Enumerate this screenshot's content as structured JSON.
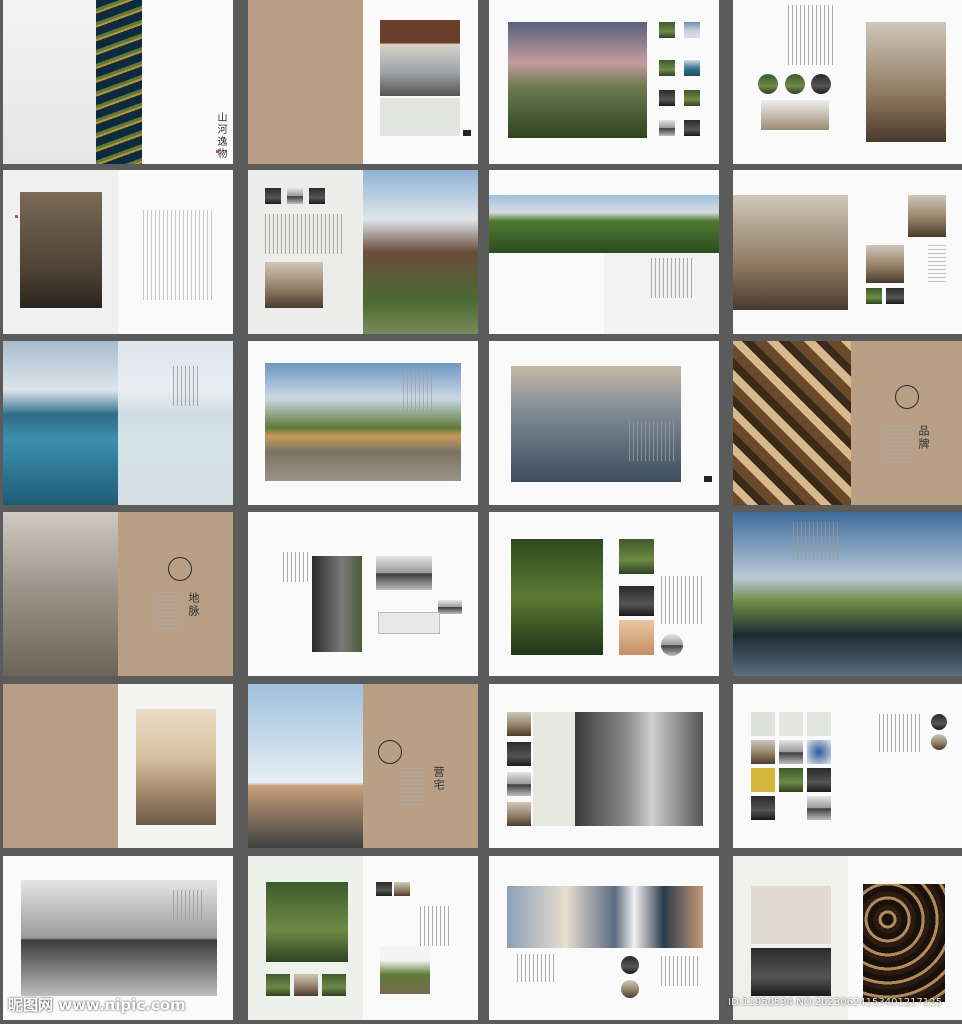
{
  "cover": {
    "title": "山河逸物"
  },
  "brand_page": {
    "title": "品牌"
  },
  "dimai_page": {
    "title": "地脉"
  },
  "yingzhai_page": {
    "title": "营宅"
  },
  "watermark": {
    "site": "昵图网 www.nipic.com",
    "id": "ID:11950534 NO:20230624153401217125"
  },
  "colors": {
    "tan": "#b89f85",
    "gutter": "#5b5b5b",
    "paper": "#fafafa",
    "accent": "#b5563a"
  },
  "icons": [
    "seal-logo-icon",
    "page-marker-icon"
  ]
}
